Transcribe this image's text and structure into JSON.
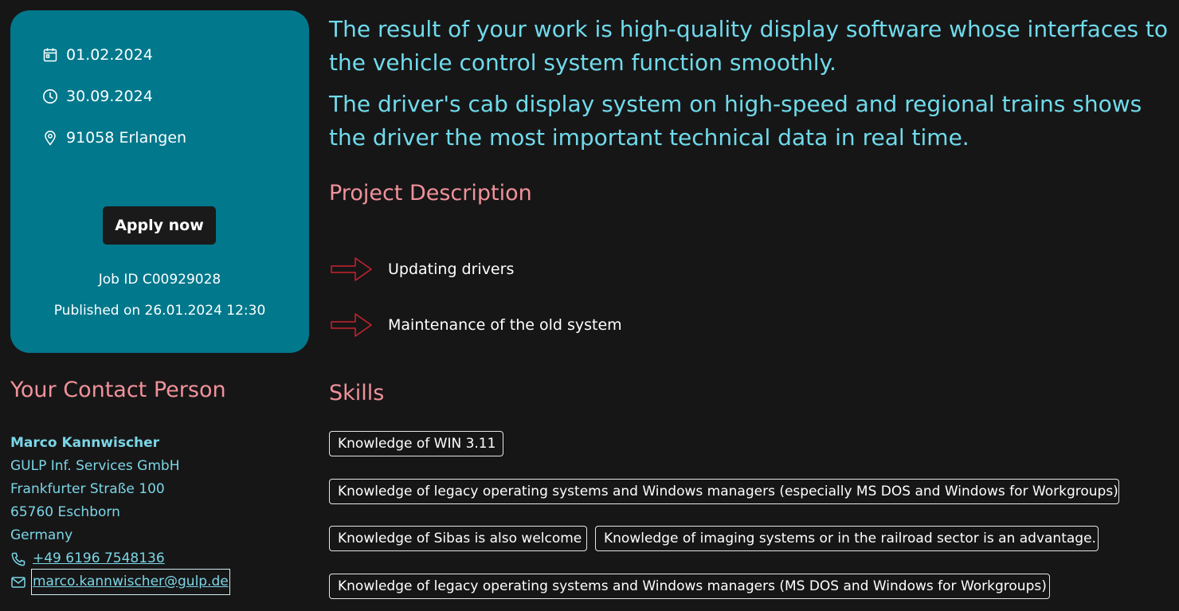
{
  "job_card": {
    "start_date": "01.02.2024",
    "end_date": "30.09.2024",
    "location": "91058 Erlangen",
    "apply_label": "Apply now",
    "job_id": "Job ID C00929028",
    "published": "Published on 26.01.2024 12:30"
  },
  "contact": {
    "title": "Your Contact Person",
    "name": "Marco Kannwischer",
    "company": "GULP Inf. Services GmbH",
    "street": "Frankfurter Straße 100",
    "city": "65760 Eschborn",
    "country": "Germany",
    "phone": "+49 6196 7548136",
    "email": "marco.kannwischer@gulp.de"
  },
  "intro": {
    "paragraph_1": "The result of your work is high-quality display software whose interfaces to the vehicle control system function smoothly.",
    "paragraph_2": "The driver's cab display system on high-speed and regional trains shows the driver the most important technical data in real time."
  },
  "project": {
    "title": "Project Description",
    "items": [
      "Updating drivers",
      "Maintenance of the old system"
    ]
  },
  "skills": {
    "title": "Skills",
    "items": [
      "Knowledge of WIN 3.11",
      "Knowledge of legacy operating systems and Windows managers (especially MS DOS and Windows for Workgroups)",
      "Knowledge of Sibas is also welcome",
      "Knowledge of imaging systems or in the railroad sector is an advantage.",
      "Knowledge of legacy operating systems and Windows managers (MS DOS and Windows for Workgroups)"
    ]
  },
  "colors": {
    "card_bg": "#01788c",
    "accent_pink": "#f0929a",
    "accent_cyan": "#6fdbeb",
    "page_bg": "#171617"
  }
}
